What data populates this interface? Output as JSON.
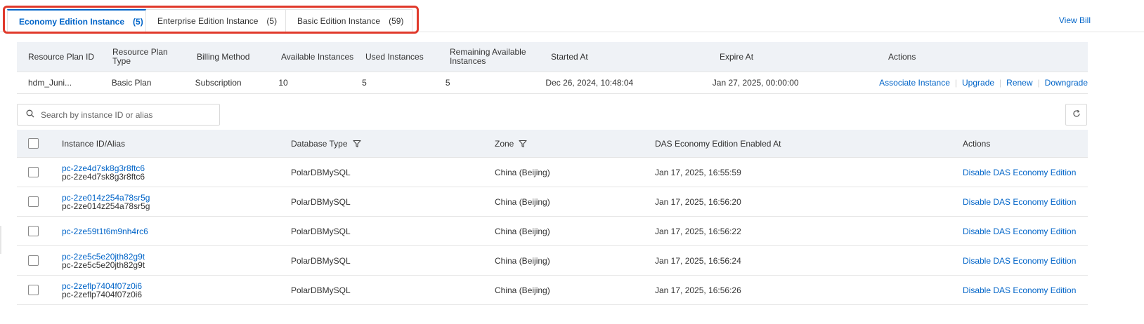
{
  "tabs": [
    {
      "label": "Economy Edition Instance",
      "count": "(5)",
      "active": true
    },
    {
      "label": "Enterprise Edition Instance",
      "count": "(5)",
      "active": false
    },
    {
      "label": "Basic Edition Instance",
      "count": "(59)",
      "active": false
    }
  ],
  "view_bill": "View Bill",
  "plan": {
    "headers": [
      "Resource Plan ID",
      "Resource Plan Type",
      "Billing Method",
      "Available Instances",
      "Used Instances",
      "Remaining Available Instances",
      "Started At",
      "Expire At",
      "Actions"
    ],
    "row": {
      "id": "hdm_Juni...",
      "type": "Basic Plan",
      "billing": "Subscription",
      "available": "10",
      "used": "5",
      "remaining": "5",
      "started": "Dec 26, 2024, 10:48:04",
      "expire": "Jan 27, 2025, 00:00:00",
      "actions": [
        "Associate Instance",
        "Upgrade",
        "Renew",
        "Downgrade"
      ]
    }
  },
  "search": {
    "placeholder": "Search by instance ID or alias"
  },
  "instances": {
    "headers": [
      "Instance ID/Alias",
      "Database Type",
      "Zone",
      "DAS Economy Edition Enabled At",
      "Actions"
    ],
    "rows": [
      {
        "id": "pc-2ze4d7sk8g3r8ftc6",
        "alias": "pc-2ze4d7sk8g3r8ftc6",
        "db": "PolarDBMySQL",
        "zone": "China (Beijing)",
        "enabled": "Jan 17, 2025, 16:55:59",
        "action": "Disable DAS Economy Edition"
      },
      {
        "id": "pc-2ze014z254a78sr5g",
        "alias": "pc-2ze014z254a78sr5g",
        "db": "PolarDBMySQL",
        "zone": "China (Beijing)",
        "enabled": "Jan 17, 2025, 16:56:20",
        "action": "Disable DAS Economy Edition"
      },
      {
        "id": "pc-2ze59t1t6m9nh4rc6",
        "alias": "",
        "db": "PolarDBMySQL",
        "zone": "China (Beijing)",
        "enabled": "Jan 17, 2025, 16:56:22",
        "action": "Disable DAS Economy Edition"
      },
      {
        "id": "pc-2ze5c5e20jth82g9t",
        "alias": "pc-2ze5c5e20jth82g9t",
        "db": "PolarDBMySQL",
        "zone": "China (Beijing)",
        "enabled": "Jan 17, 2025, 16:56:24",
        "action": "Disable DAS Economy Edition"
      },
      {
        "id": "pc-2zeflp7404f07z0i6",
        "alias": "pc-2zeflp7404f07z0i6",
        "db": "PolarDBMySQL",
        "zone": "China (Beijing)",
        "enabled": "Jan 17, 2025, 16:56:26",
        "action": "Disable DAS Economy Edition"
      }
    ]
  },
  "icons": {
    "search": "search-icon",
    "refresh": "refresh-icon",
    "filter": "filter-icon"
  },
  "colors": {
    "accent": "#0064c8",
    "highlight": "#e0392b",
    "header_bg": "#eff2f6"
  }
}
